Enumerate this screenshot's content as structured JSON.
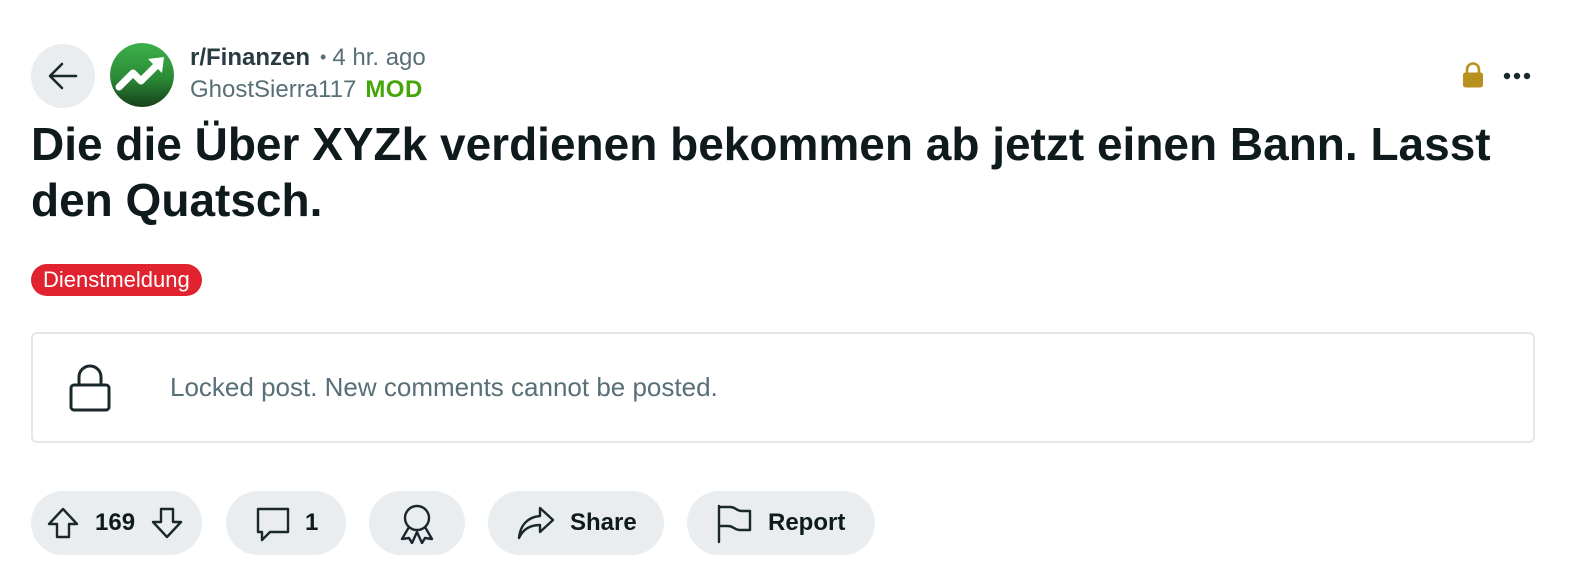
{
  "header": {
    "subreddit": "r/Finanzen",
    "separator": "•",
    "time_ago": "4 hr. ago",
    "author": "GhostSierra117",
    "author_badge": "MOD"
  },
  "post": {
    "title": "Die die Über XYZk verdienen bekommen ab jetzt einen Bann. Lasst den Quatsch.",
    "flair": "Dienstmeldung",
    "locked_notice": "Locked post. New comments cannot be posted."
  },
  "actions": {
    "vote_count": "169",
    "comment_count": "1",
    "share_label": "Share",
    "report_label": "Report"
  },
  "colors": {
    "flair_bg": "#e0232f",
    "mod_green": "#46a508",
    "lock_gold": "#b8901f",
    "pill_bg": "#eaedef"
  },
  "icons": [
    "back-arrow-icon",
    "subreddit-avatar",
    "lock-icon",
    "more-icon",
    "upvote-icon",
    "downvote-icon",
    "comment-icon",
    "award-icon",
    "share-icon",
    "report-flag-icon"
  ]
}
